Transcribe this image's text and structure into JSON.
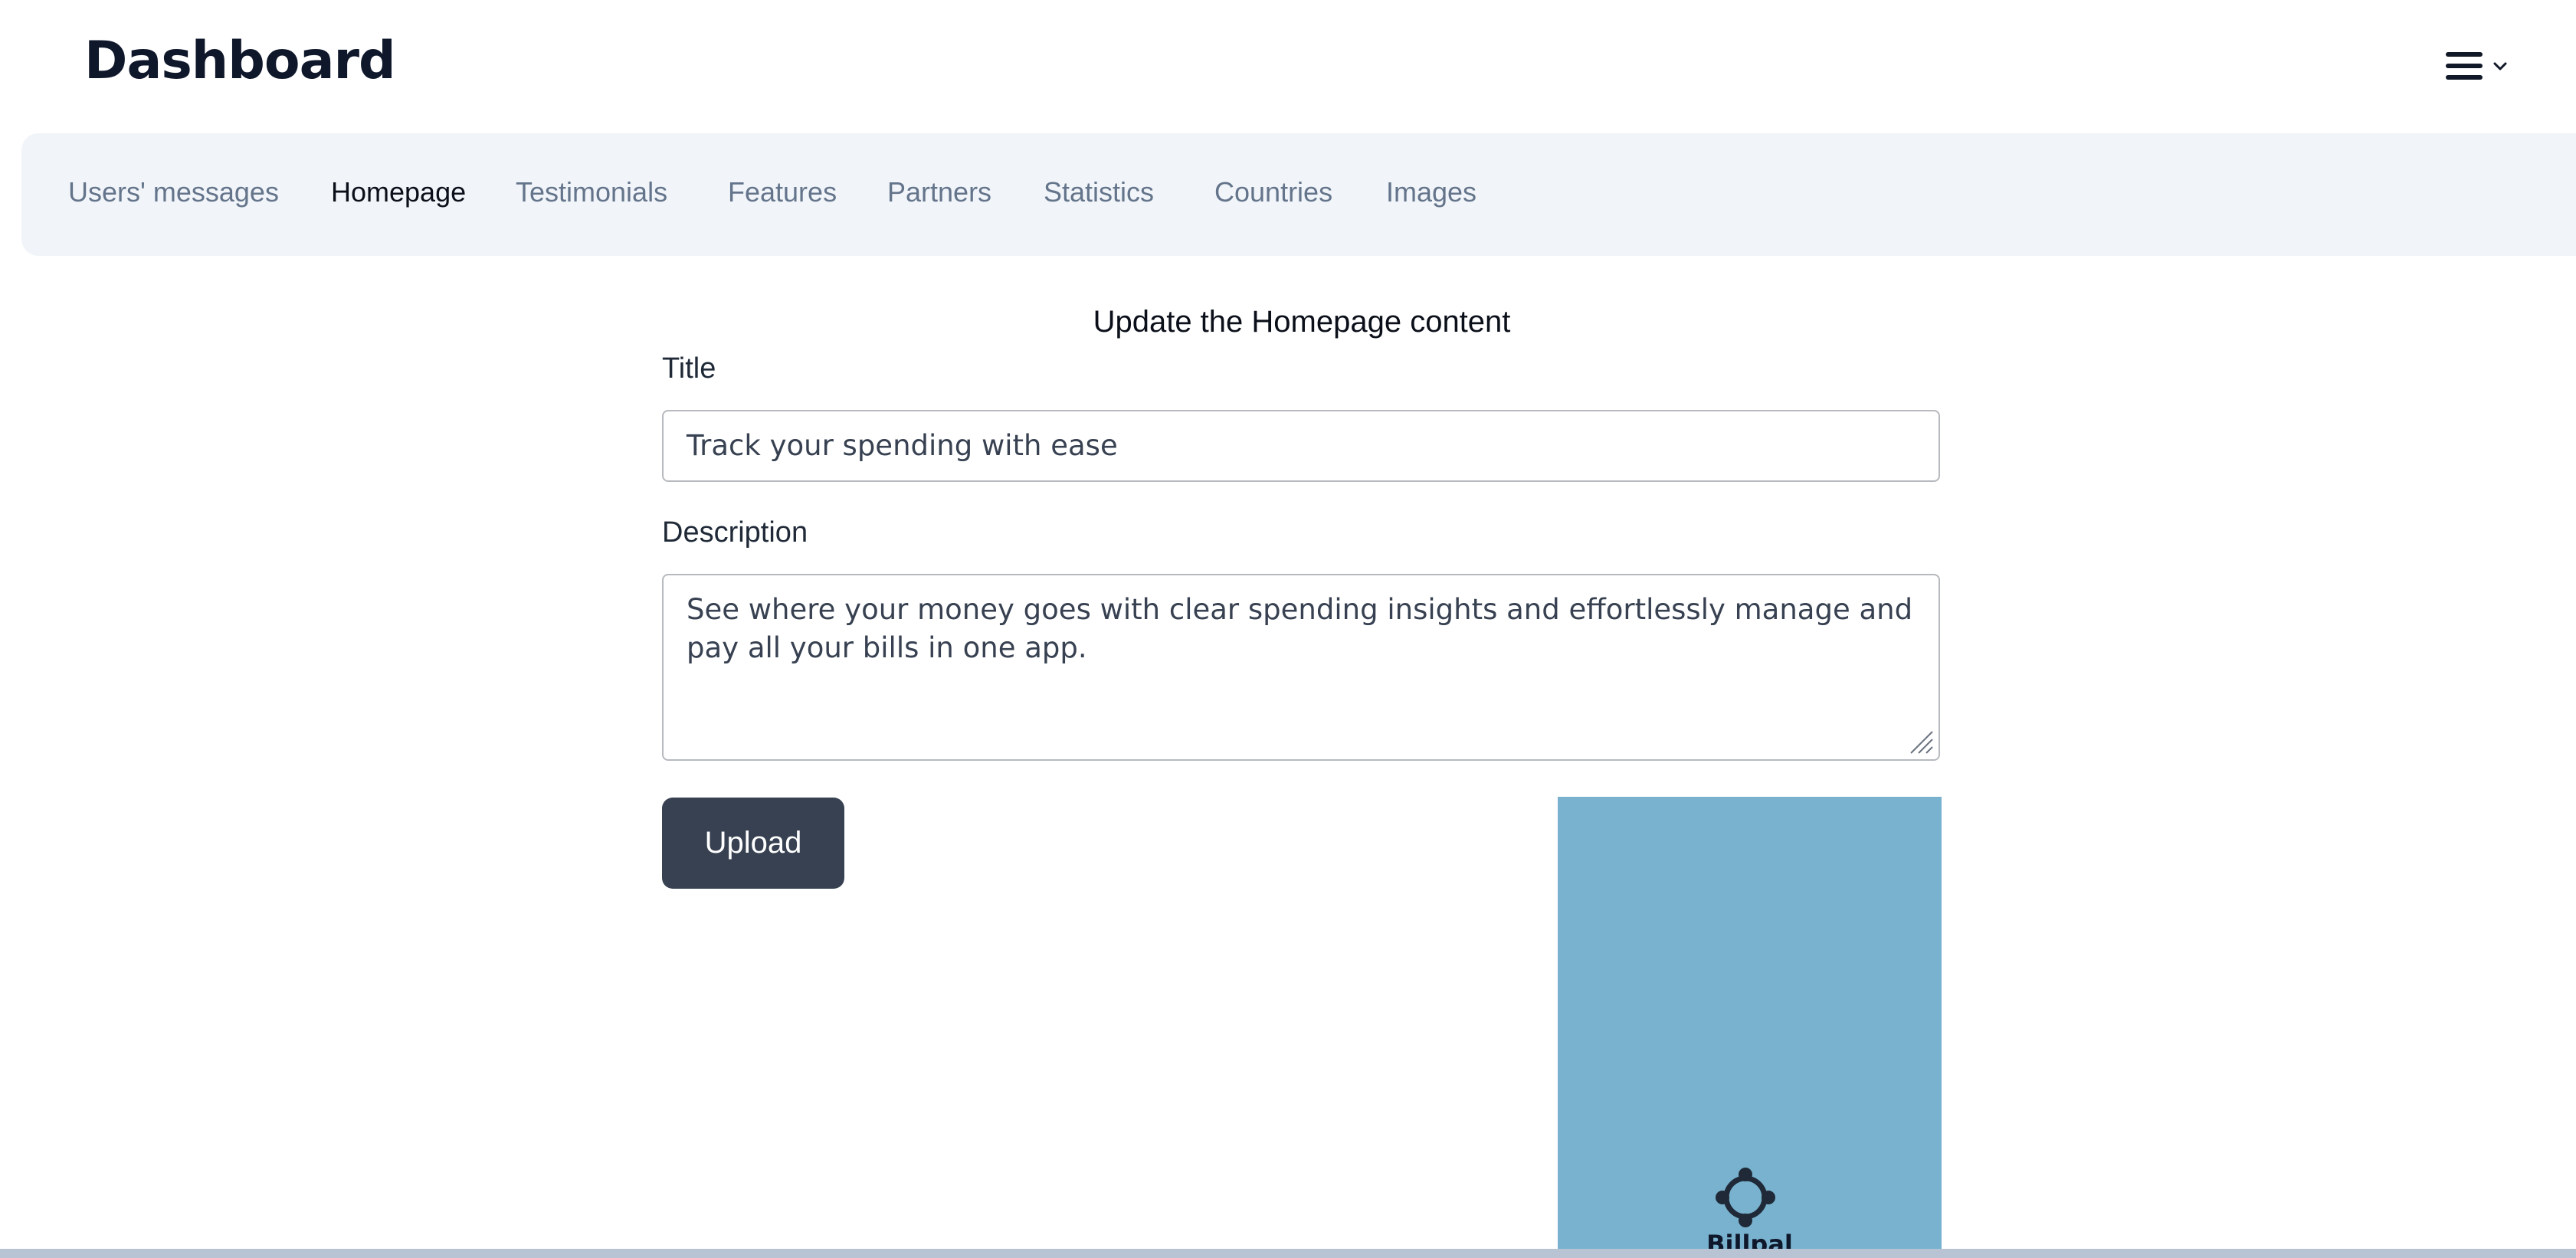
{
  "header": {
    "brand": "Dashboard",
    "menu_icon": "hamburger-menu-icon"
  },
  "nav": {
    "items": [
      {
        "label": "Users' messages",
        "active": false
      },
      {
        "label": "Homepage",
        "active": true
      },
      {
        "label": "Testimonials",
        "active": false
      },
      {
        "label": "Features",
        "active": false
      },
      {
        "label": "Partners",
        "active": false
      },
      {
        "label": "Statistics",
        "active": false
      },
      {
        "label": "Countries",
        "active": false
      },
      {
        "label": "Images",
        "active": false
      }
    ]
  },
  "form": {
    "heading": "Update the Homepage content",
    "title_label": "Title",
    "title_value": "Track your spending with ease",
    "description_label": "Description",
    "description_value": "See where your money goes with clear spending insights and effortlessly manage and pay all your bills in one app.",
    "upload_label": "Upload"
  },
  "preview": {
    "logo_icon": "billpal-logo-icon",
    "logo_text": "Billpal"
  },
  "colors": {
    "nav_background": "#f1f5f9",
    "button_background": "#374151",
    "preview_background": "#78b2ce",
    "inactive_nav_text": "#64748b"
  }
}
